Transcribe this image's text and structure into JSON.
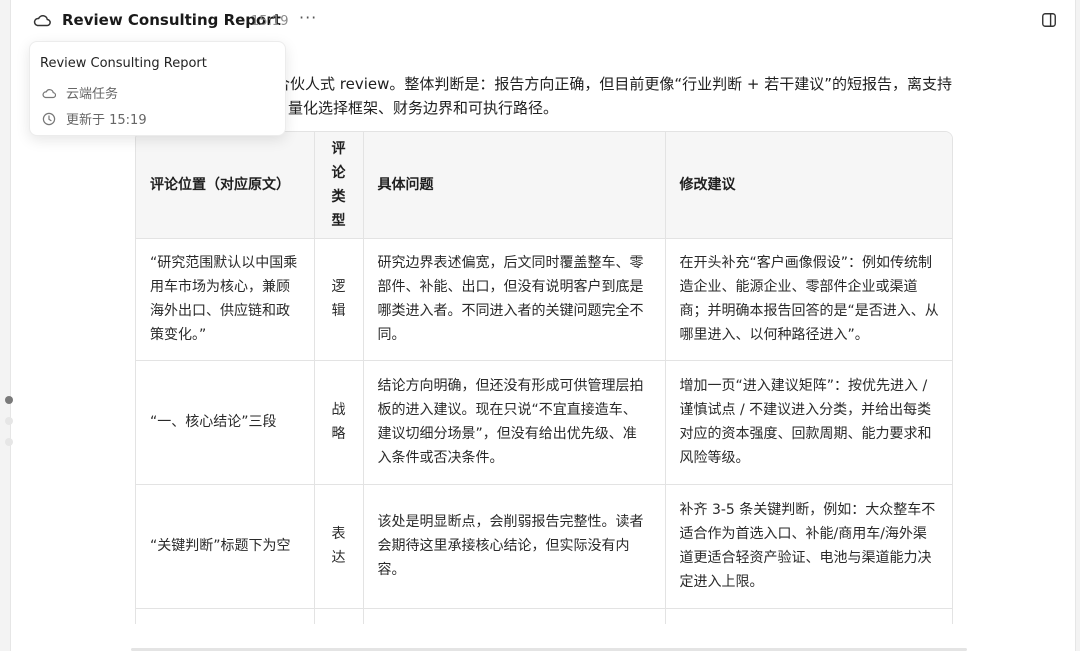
{
  "header": {
    "title": "Review Consulting Report",
    "time": "15:19",
    "more_label": "···"
  },
  "popup": {
    "title": "Review Consulting Report",
    "cloud_task": "云端任务",
    "updated": "更新于 15:19"
  },
  "intro": {
    "line1": "合伙人式 review。整体判断是：报告方向正确，但目前更像“行业判断 + 若干建议”的短报告，离支持",
    "line2": "量化选择框架、财务边界和可执行路径。"
  },
  "table": {
    "headers": {
      "location": "评论位置（对应原文）",
      "type": "评论类型",
      "issue": "具体问题",
      "suggestion": "修改建议"
    },
    "rows": [
      {
        "location": "“研究范围默认以中国乘用车市场为核心，兼顾海外出口、供应链和政策变化。”",
        "type": "逻辑",
        "issue": "研究边界表述偏宽，后文同时覆盖整车、零部件、补能、出口，但没有说明客户到底是哪类进入者。不同进入者的关键问题完全不同。",
        "suggestion": "在开头补充“客户画像假设”：例如传统制造企业、能源企业、零部件企业或渠道商；并明确本报告回答的是“是否进入、从哪里进入、以何种路径进入”。"
      },
      {
        "location": "“一、核心结论”三段",
        "type": "战略",
        "issue": "结论方向明确，但还没有形成可供管理层拍板的进入建议。现在只说“不宜直接造车、建议切细分场景”，但没有给出优先级、准入条件或否决条件。",
        "suggestion": "增加一页“进入建议矩阵”：按优先进入 / 谨慎试点 / 不建议进入分类，并给出每类对应的资本强度、回款周期、能力要求和风险等级。"
      },
      {
        "location": "“关键判断”标题下为空",
        "type": "表达",
        "issue": "该处是明显断点，会削弱报告完整性。读者会期待这里承接核心结论，但实际没有内容。",
        "suggestion": "补齐 3-5 条关键判断，例如：大众整车不适合作为首选入口、补能/商用车/海外渠道更适合轻资产验证、电池与渠道能力决定进入上限。"
      }
    ]
  },
  "dots": {
    "count": 3,
    "active_index": 0
  }
}
